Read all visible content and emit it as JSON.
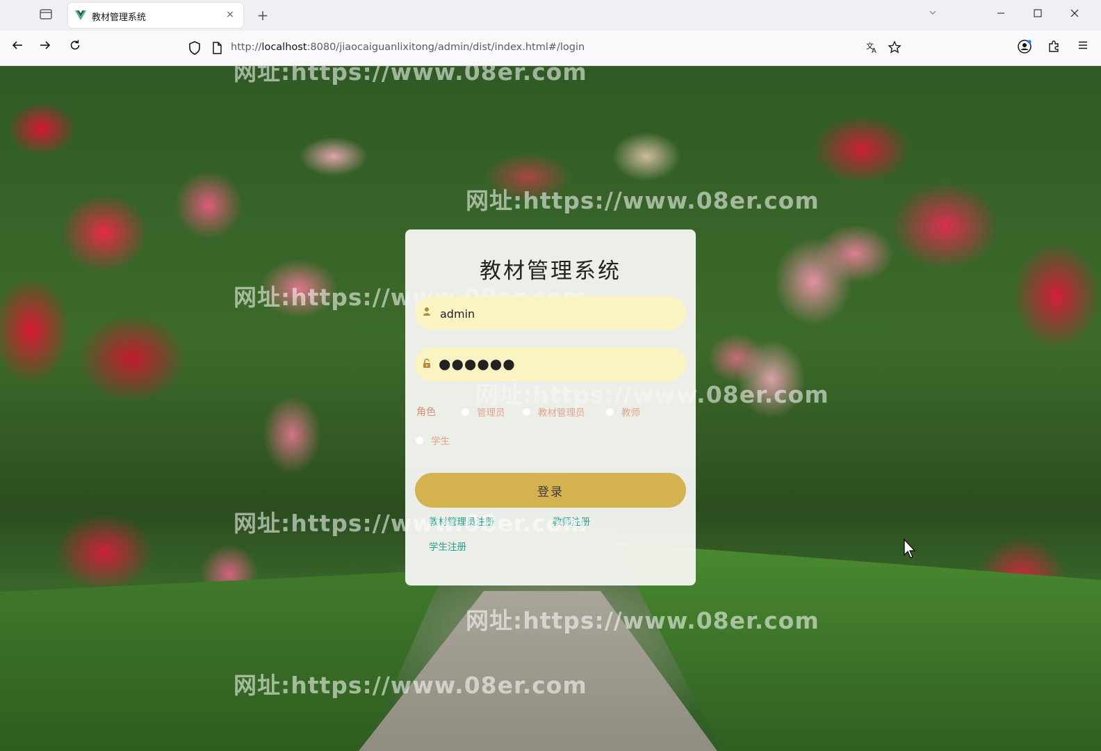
{
  "browser": {
    "tab_title": "教材管理系统",
    "new_tab_symbol": "+",
    "close_symbol": "×",
    "url_scheme": "http://",
    "url_host": "localhost",
    "url_path": ":8080/jiaocaiguanlixitong/admin/dist/index.html#/login",
    "icons": [
      "tab-list-icon",
      "vue-favicon-icon",
      "back-arrow-icon",
      "forward-arrow-icon",
      "reload-icon",
      "shield-icon",
      "page-icon",
      "translate-icon",
      "bookmark-star-icon",
      "account-icon",
      "extensions-icon",
      "menu-icon",
      "minimize-icon",
      "maximize-icon",
      "close-icon"
    ]
  },
  "watermark": {
    "text": "网址:https://www.08er.com"
  },
  "login": {
    "title": "教材管理系统",
    "username_value": "admin",
    "password_value": "●●●●●●",
    "role_label": "角色",
    "roles": [
      "管理员",
      "教材管理员",
      "教师",
      "学生"
    ],
    "submit_label": "登录",
    "links": [
      "教材管理员注册",
      "教师注册",
      "学生注册"
    ]
  },
  "colors": {
    "field_bg": "#fbf4c2",
    "button_bg": "#d3b24f",
    "link": "#25a08a",
    "role_text": "#d98e73"
  }
}
